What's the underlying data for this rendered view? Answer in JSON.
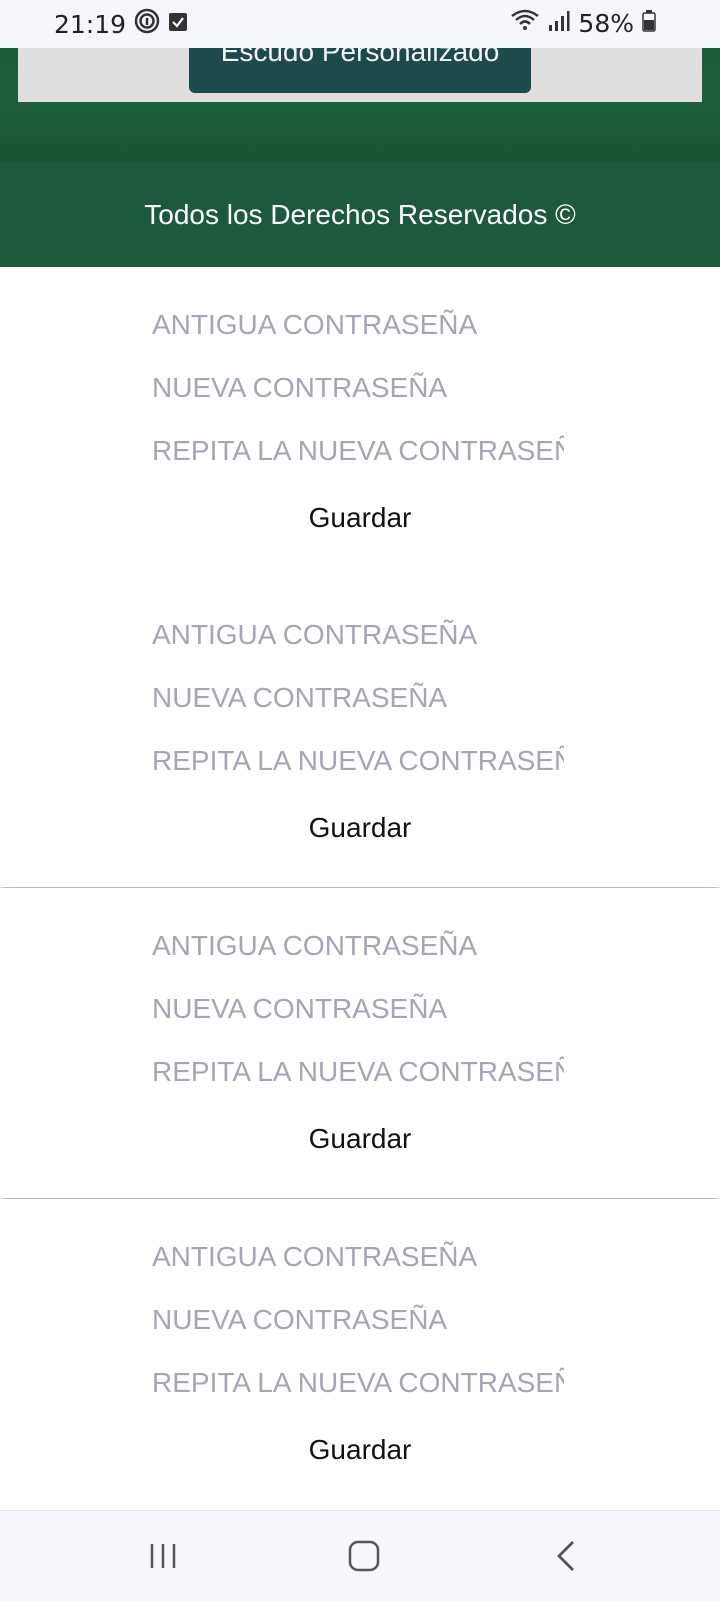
{
  "status_bar": {
    "time": "21:19",
    "battery": "58%",
    "icons": [
      "fingerprint-icon",
      "checkbox-notification-icon",
      "wifi-icon",
      "signal-icon",
      "battery-icon"
    ]
  },
  "header": {
    "shield_button_label": "Escudo Personalizado",
    "copyright": "Todos los Derechos Reservados ©"
  },
  "forms": [
    {
      "old_placeholder": "ANTIGUA CONTRASEÑA",
      "new_placeholder": "NUEVA CONTRASEÑA",
      "repeat_placeholder": "REPITA LA NUEVA CONTRASEÑA",
      "save_label": "Guardar"
    },
    {
      "old_placeholder": "ANTIGUA CONTRASEÑA",
      "new_placeholder": "NUEVA CONTRASEÑA",
      "repeat_placeholder": "REPITA LA NUEVA CONTRASEÑA",
      "save_label": "Guardar"
    },
    {
      "old_placeholder": "ANTIGUA CONTRASEÑA",
      "new_placeholder": "NUEVA CONTRASEÑA",
      "repeat_placeholder": "REPITA LA NUEVA CONTRASEÑA",
      "save_label": "Guardar"
    },
    {
      "old_placeholder": "ANTIGUA CONTRASEÑA",
      "new_placeholder": "NUEVA CONTRASEÑA",
      "repeat_placeholder": "REPITA LA NUEVA CONTRASEÑA",
      "save_label": "Guardar"
    }
  ],
  "nav_bar": {
    "buttons": [
      "recent-apps-icon",
      "home-icon",
      "back-icon"
    ]
  },
  "colors": {
    "header_green": "#1d5a3c",
    "button_teal": "#1d4a4b",
    "placeholder_gray": "#a3a7b3"
  }
}
